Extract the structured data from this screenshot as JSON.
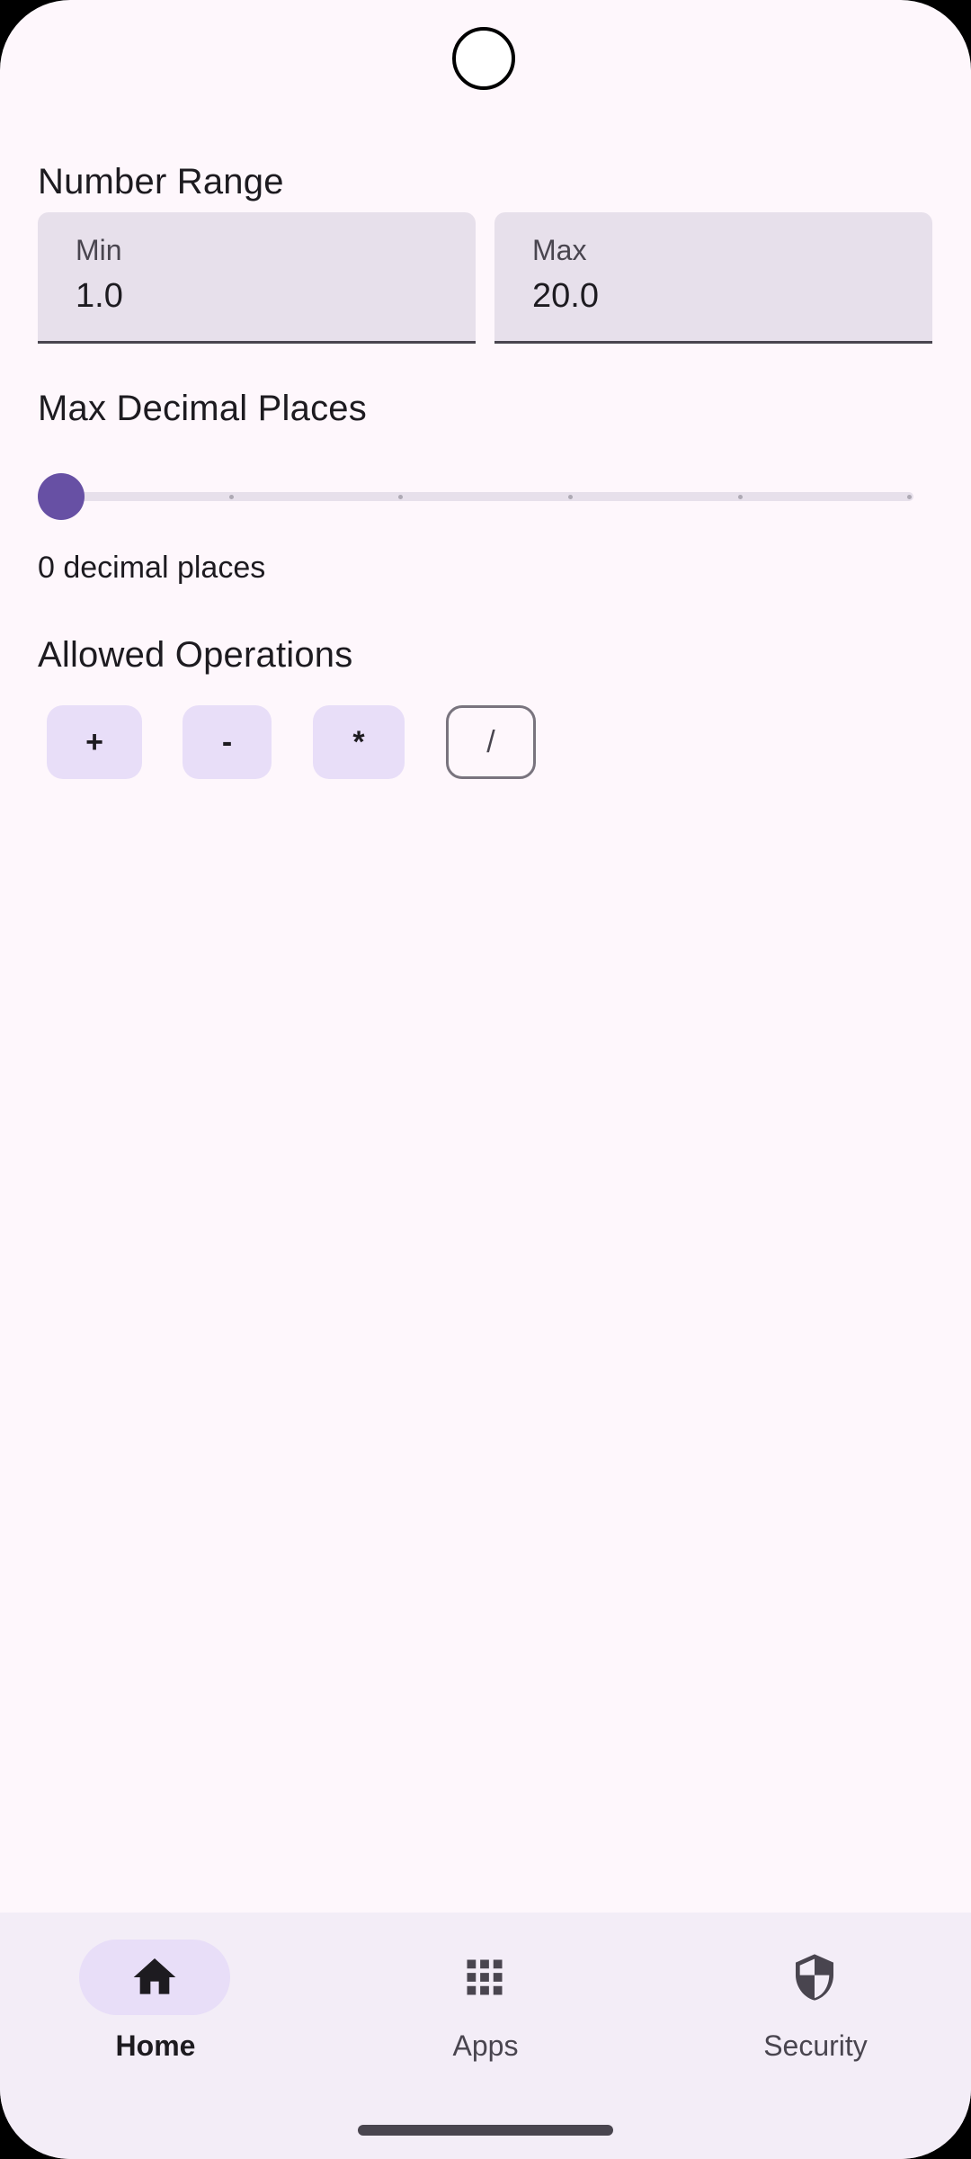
{
  "number_range": {
    "title": "Number Range",
    "min_label": "Min",
    "min_value": "1.0",
    "max_label": "Max",
    "max_value": "20.0"
  },
  "decimals": {
    "title": "Max Decimal Places",
    "slider_value": 0,
    "slider_max": 5,
    "value_text": "0 decimal places"
  },
  "operations": {
    "title": "Allowed Operations",
    "chips": [
      {
        "label": "+",
        "selected": true
      },
      {
        "label": "-",
        "selected": true
      },
      {
        "label": "*",
        "selected": true
      },
      {
        "label": "/",
        "selected": false
      }
    ]
  },
  "nav": {
    "items": [
      {
        "label": "Home",
        "icon": "home-icon",
        "active": true
      },
      {
        "label": "Apps",
        "icon": "apps-grid-icon",
        "active": false
      },
      {
        "label": "Security",
        "icon": "shield-icon",
        "active": false
      }
    ]
  },
  "colors": {
    "background": "#fef7fc",
    "accent": "#6750a4",
    "chip_selected": "#e8def8",
    "field_bg": "#e7e0eb",
    "nav_bg": "#f3edf7"
  }
}
